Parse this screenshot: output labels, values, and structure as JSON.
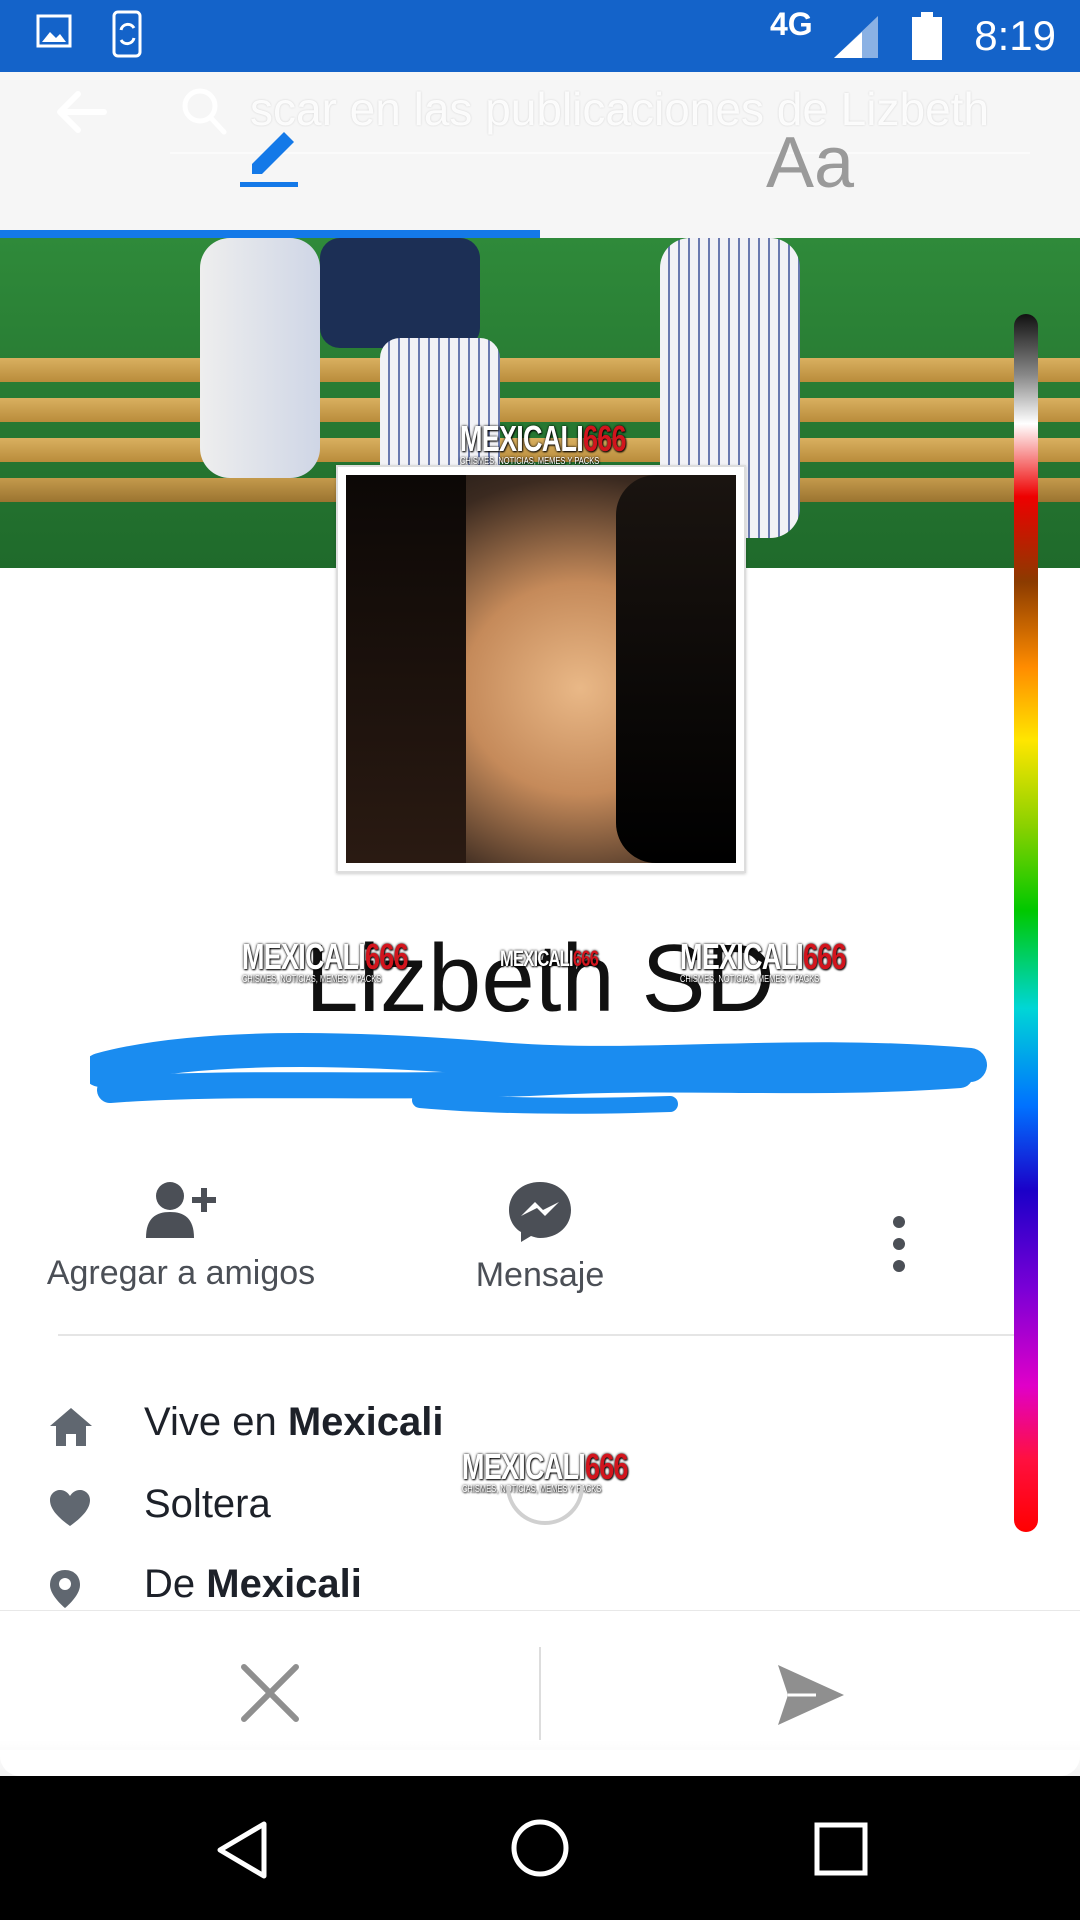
{
  "status_bar": {
    "network": "4G",
    "time": "8:19",
    "icons": [
      "gallery-icon",
      "phone-sync-icon",
      "signal-icon",
      "battery-icon"
    ]
  },
  "header": {
    "search_placeholder": "scar en las publicaciones de Lizbeth",
    "tab_text_label": "Aa",
    "icons": [
      "back-arrow-icon",
      "search-icon",
      "pencil-icon"
    ]
  },
  "watermark": {
    "brand_white": "MEXICALI",
    "brand_red": "666",
    "tagline": "CHISMES, NOTICIAS, MEMES Y PACKS"
  },
  "profile": {
    "name": "Lizbeth SD"
  },
  "actions": {
    "add_friend": "Agregar a amigos",
    "message": "Mensaje"
  },
  "info": {
    "lives_prefix": "Vive en ",
    "lives_city": "Mexicali",
    "relationship": "Soltera",
    "from_prefix": "De ",
    "from_city": "Mexicali"
  },
  "colors": {
    "status_bar": "#1463c9",
    "accent": "#1479e8",
    "icon_gray": "#606770"
  }
}
